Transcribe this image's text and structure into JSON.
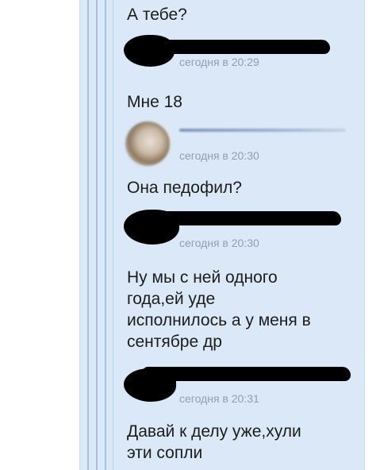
{
  "messages": [
    {
      "text": "А тебе?"
    },
    {
      "time": "сегодня в 20:29"
    },
    {
      "text": "Мне 18"
    },
    {
      "time": "сегодня в 20:30"
    },
    {
      "text": "Она педофил?"
    },
    {
      "time": "сегодня в 20:30"
    },
    {
      "lines": [
        "Ну мы с ней одного",
        "года,ей уде",
        "исполнилось а у меня в",
        "сентябре др"
      ]
    },
    {
      "time": "сегодня в 20:31"
    },
    {
      "lines": [
        "Давай к делу уже,хули",
        "эти сопли"
      ]
    }
  ],
  "colors": {
    "panel_background": "#dbe8f7",
    "rail": "#a9c0dd",
    "message_text": "#1c1c1c",
    "timestamp_text": "#8f9fb4",
    "redaction": "#000000"
  },
  "icons": {
    "redacted_avatar": "scribbled-out-avatar",
    "blurred_avatar": "blurred-photo-avatar"
  }
}
